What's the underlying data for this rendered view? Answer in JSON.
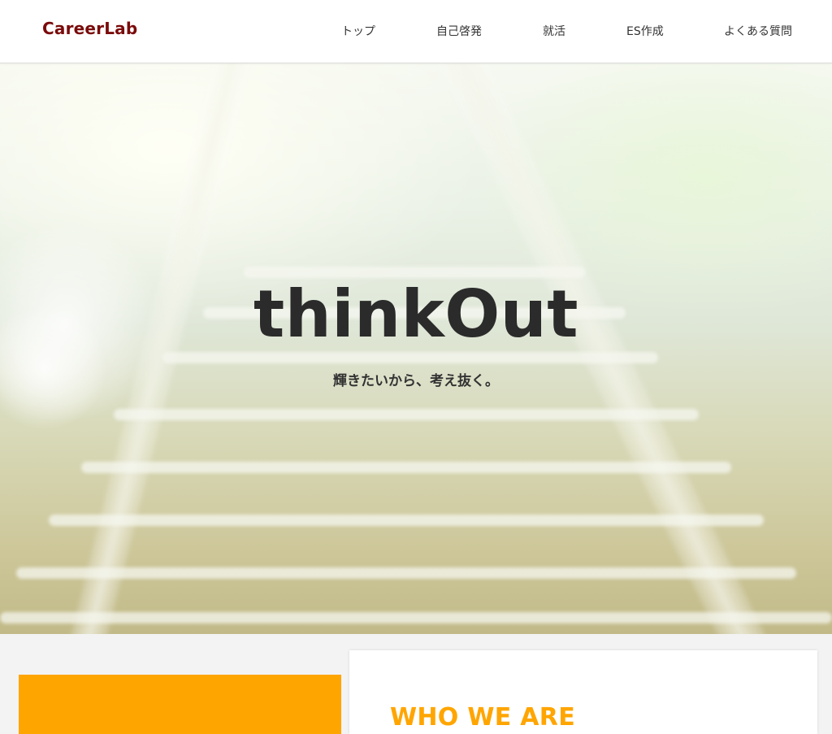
{
  "header": {
    "logo": "CareerLab",
    "nav": [
      {
        "label": "トップ"
      },
      {
        "label": "自己啓発"
      },
      {
        "label": "就活"
      },
      {
        "label": "ES作成"
      },
      {
        "label": "よくある質問"
      }
    ]
  },
  "hero": {
    "title": "thinkOut",
    "subtitle": "輝きたいから、考え抜く。"
  },
  "about": {
    "heading": "WHO WE ARE"
  },
  "colors": {
    "brand": "#7a0b0b",
    "accent": "#ffa500",
    "text": "#333333"
  }
}
